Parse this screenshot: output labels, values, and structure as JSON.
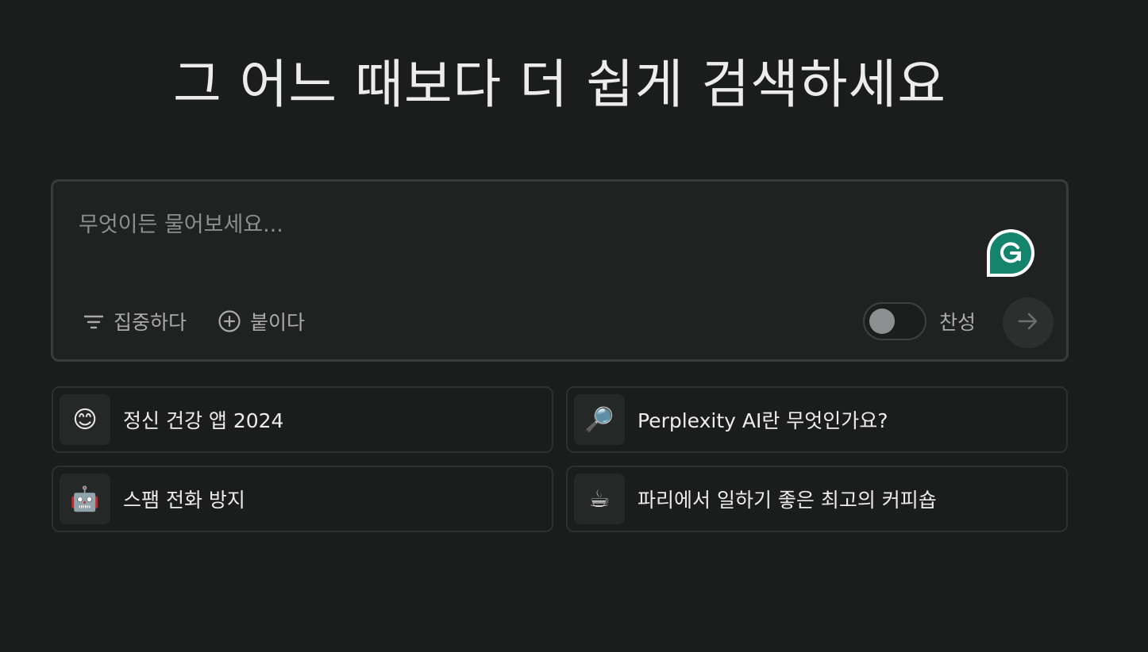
{
  "headline": "그 어느 때보다 더 쉽게 검색하세요",
  "search": {
    "placeholder": "무엇이든 물어보세요...",
    "value": ""
  },
  "toolbar": {
    "focus_label": "집중하다",
    "attach_label": "붙이다",
    "pro_label": "찬성",
    "pro_enabled": false
  },
  "suggestions": [
    {
      "emoji": "😊",
      "icon": "smiling-face-icon",
      "label": "정신 건강 앱 2024"
    },
    {
      "emoji": "🔎",
      "icon": "magnifying-glass-icon",
      "label": "Perplexity AI란 무엇인가요?"
    },
    {
      "emoji": "🤖",
      "icon": "robot-icon",
      "label": "스팸 전화 방지"
    },
    {
      "emoji": "☕",
      "icon": "coffee-icon",
      "label": "파리에서 일하기 좋은 최고의 커피숍"
    }
  ],
  "colors": {
    "background": "#1b1c1c",
    "grammarly": "#15846c"
  }
}
